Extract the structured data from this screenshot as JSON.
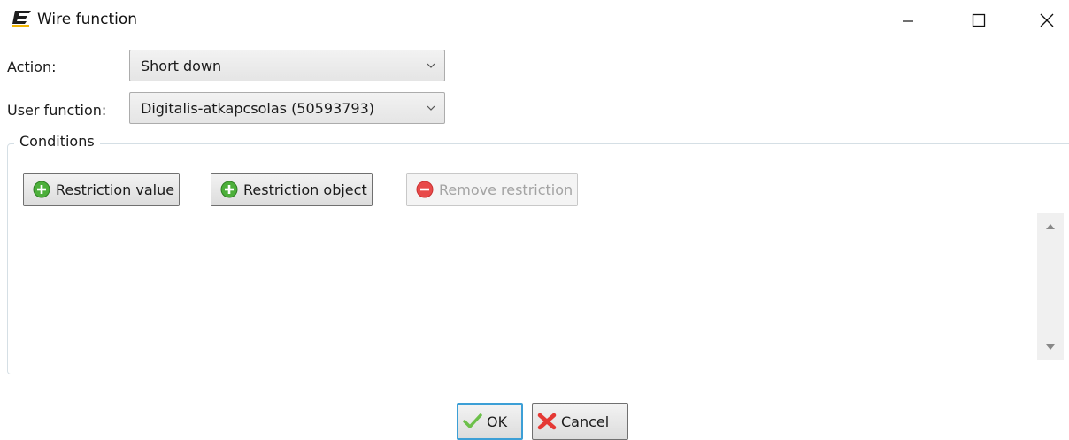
{
  "window": {
    "title": "Wire function",
    "app_icon": "app-logo-e",
    "controls": [
      "minimize-icon",
      "maximize-icon",
      "close-icon"
    ]
  },
  "form": {
    "action": {
      "label": "Action:",
      "value": "Short down"
    },
    "user_function": {
      "label": "User function:",
      "value": "Digitalis-atkapcsolas (50593793)"
    }
  },
  "conditions": {
    "title": "Conditions",
    "buttons": [
      {
        "label": "Restriction value",
        "icon": "plus-circle-icon",
        "enabled": true
      },
      {
        "label": "Restriction object",
        "icon": "plus-circle-icon",
        "enabled": true
      },
      {
        "label": "Remove restriction",
        "icon": "minus-circle-icon",
        "enabled": false
      }
    ]
  },
  "dialog_buttons": {
    "ok": {
      "label": "OK",
      "icon": "checkmark-icon"
    },
    "cancel": {
      "label": "Cancel",
      "icon": "x-icon"
    }
  },
  "colors": {
    "accent_border": "#3c9fd6",
    "add_green": "#4caf3a",
    "remove_red": "#e84a4a",
    "cancel_red": "#e53935"
  }
}
